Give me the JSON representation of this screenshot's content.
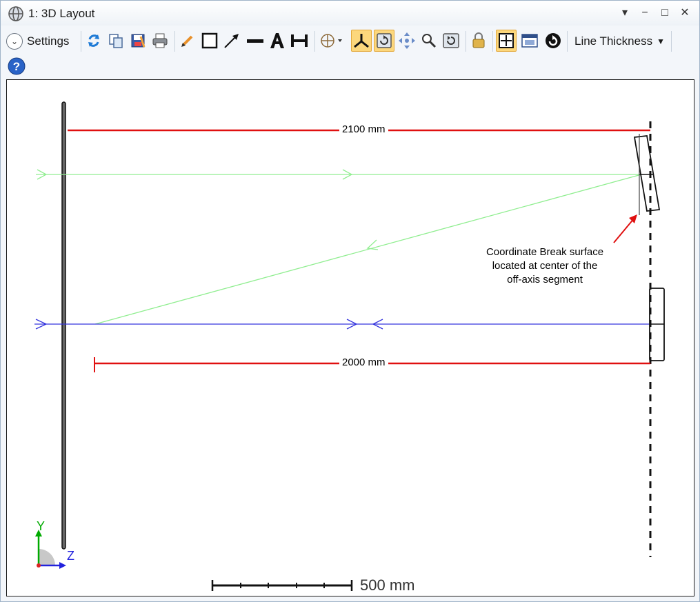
{
  "window": {
    "title": "1: 3D Layout",
    "controls": {
      "dropdown": "▾",
      "minimize": "−",
      "maximize": "□",
      "close": "✕"
    }
  },
  "toolbar": {
    "settings_label": "Settings",
    "line_thickness_label": "Line Thickness",
    "buttons": [
      {
        "name": "refresh-icon"
      },
      {
        "name": "copy-icon"
      },
      {
        "name": "save-icon"
      },
      {
        "name": "print-icon"
      },
      {
        "name": "pencil-icon"
      },
      {
        "name": "rectangle-icon"
      },
      {
        "name": "arrow-icon"
      },
      {
        "name": "line-icon"
      },
      {
        "name": "text-icon"
      },
      {
        "name": "dimension-icon"
      },
      {
        "name": "rotate-view-icon"
      },
      {
        "name": "axes-icon",
        "active": true
      },
      {
        "name": "auto-apply-icon",
        "active": true
      },
      {
        "name": "pan-icon"
      },
      {
        "name": "zoom-icon"
      },
      {
        "name": "reset-view-icon"
      },
      {
        "name": "lock-icon"
      },
      {
        "name": "fit-icon",
        "active": true
      },
      {
        "name": "window-icon"
      },
      {
        "name": "reload-icon"
      }
    ]
  },
  "layout": {
    "dimension_top": "2100 mm",
    "dimension_bottom": "2000 mm",
    "annotation": [
      "Coordinate Break surface",
      "located at center of the",
      "off-axis segment"
    ],
    "axis_y": "Y",
    "axis_z": "Z",
    "scale_bar": "500 mm",
    "colors": {
      "green_ray": "#90ee90",
      "blue_ray": "#3333dd",
      "dimension": "#e01010",
      "axis_y": "#00aa00",
      "axis_z": "#2222dd"
    }
  }
}
